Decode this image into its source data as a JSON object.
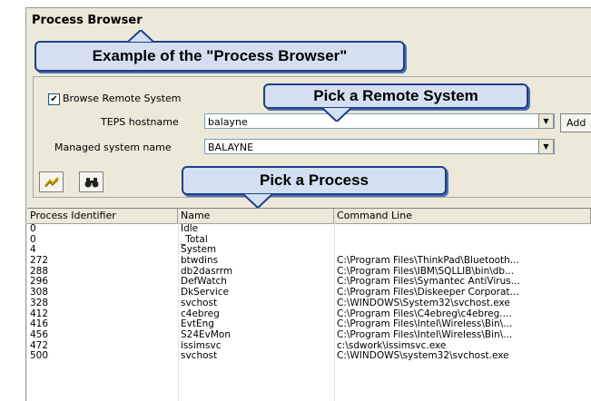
{
  "window": {
    "title": "Process Browser"
  },
  "callouts": {
    "example": "Example of the \"Process Browser\"",
    "remote": "Pick a Remote System",
    "process": "Pick a Process"
  },
  "remote": {
    "browse_label": "Browse Remote System",
    "browse_checked": "✔",
    "teps_label": "TEPS hostname",
    "teps_value": "balayne",
    "add_button": "Add",
    "managed_label": "Managed system name",
    "managed_value": "BALAYNE"
  },
  "toolbar": {
    "refresh_icon": "refresh-icon",
    "find_icon": "binoculars-icon"
  },
  "table": {
    "columns": [
      "Process Identifier",
      "Name",
      "Command Line"
    ],
    "rows": [
      [
        "0",
        "Idle",
        ""
      ],
      [
        "0",
        "_Total",
        ""
      ],
      [
        "4",
        "System",
        ""
      ],
      [
        "272",
        "btwdins",
        "C:\\Program Files\\ThinkPad\\Bluetooth..."
      ],
      [
        "288",
        "db2dasrrm",
        "C:\\Program Files\\IBM\\SQLLIB\\bin\\db..."
      ],
      [
        "296",
        "DefWatch",
        "C:\\Program Files\\Symantec AntiVirus..."
      ],
      [
        "308",
        "DkService",
        "C:\\Program Files\\Diskeeper Corporat..."
      ],
      [
        "328",
        "svchost",
        "C:\\WINDOWS\\System32\\svchost.exe"
      ],
      [
        "412",
        "c4ebreg",
        "C:\\Program Files\\C4ebreg\\c4ebreg...."
      ],
      [
        "416",
        "EvtEng",
        "C:\\Program Files\\Intel\\Wireless\\Bin\\..."
      ],
      [
        "456",
        "S24EvMon",
        "C:\\Program Files\\Intel\\Wireless\\Bin\\..."
      ],
      [
        "472",
        "issimsvc",
        "c:\\sdwork\\issimsvc.exe"
      ],
      [
        "500",
        "svchost",
        "C:\\WINDOWS\\system32\\svchost.exe"
      ]
    ]
  }
}
